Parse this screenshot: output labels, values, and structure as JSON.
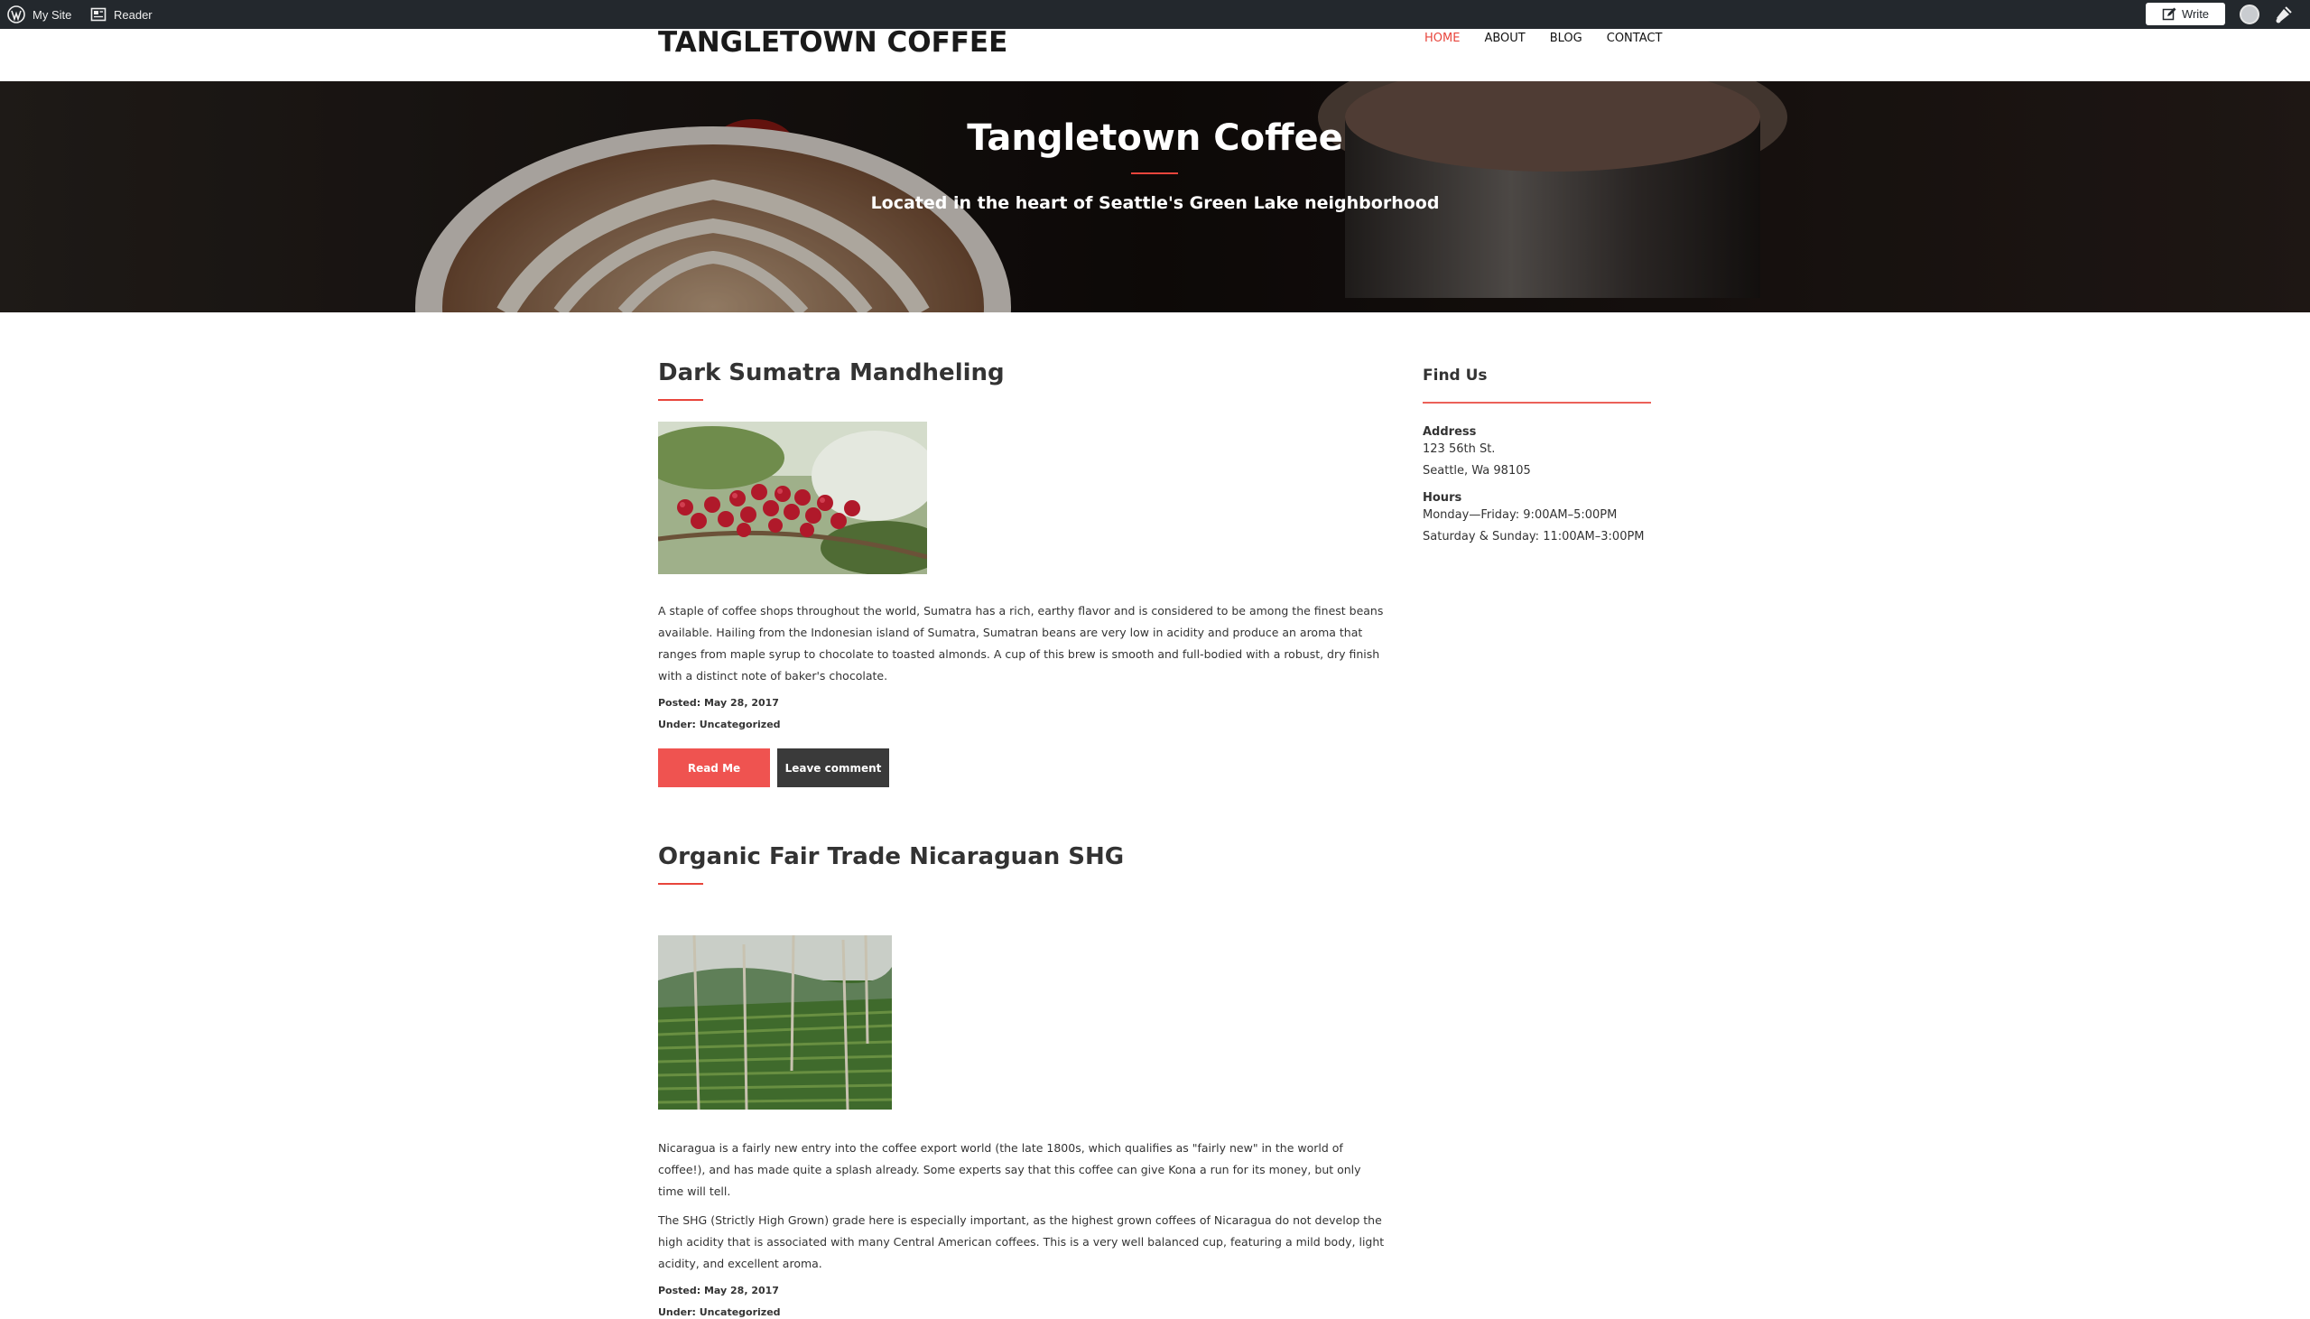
{
  "adminbar": {
    "my_site": "My Site",
    "reader": "Reader",
    "write": "Write"
  },
  "header": {
    "site_title": "TANGLETOWN COFFEE",
    "nav": [
      {
        "label": "HOME",
        "active": true
      },
      {
        "label": "ABOUT",
        "active": false
      },
      {
        "label": "BLOG",
        "active": false
      },
      {
        "label": "CONTACT",
        "active": false
      }
    ]
  },
  "hero": {
    "title": "Tangletown Coffee",
    "subtitle": "Located in the heart of Seattle's Green Lake neighborhood"
  },
  "posts": [
    {
      "title": "Dark Sumatra Mandheling",
      "paragraphs": [
        "A staple of coffee shops throughout the world, Sumatra has a rich, earthy flavor and is considered to be among the finest beans available. Hailing from the Indonesian island of Sumatra, Sumatran beans are very low in acidity and produce an aroma that ranges from maple syrup to chocolate to toasted almonds. A cup of this brew is smooth and full-bodied with a robust, dry finish with a distinct note of baker's chocolate."
      ],
      "posted": "Posted: May 28, 2017",
      "under": "Under: Uncategorized",
      "read_label": "Read Me",
      "comment_label": "Leave comment"
    },
    {
      "title": "Organic Fair Trade Nicaraguan SHG",
      "paragraphs": [
        "Nicaragua is a fairly new entry into the coffee export world (the late 1800s, which qualifies as \"fairly new\" in the world of coffee!), and has made quite a splash already. Some experts say that this coffee can give Kona a run for its money, but only time will tell.",
        "The SHG (Strictly High Grown) grade here is especially important, as the highest grown coffees of Nicaragua do not develop the high acidity that is associated with many Central American coffees. This is a very well balanced cup, featuring a mild body, light acidity, and excellent aroma."
      ],
      "posted": "Posted: May 28, 2017",
      "under": "Under: Uncategorized"
    }
  ],
  "sidebar": {
    "widget_title": "Find Us",
    "address_label": "Address",
    "address_line1": "123 56th St.",
    "address_line2": "Seattle, Wa 98105",
    "hours_label": "Hours",
    "hours_line1": "Monday—Friday: 9:00AM–5:00PM",
    "hours_line2": "Saturday & Sunday: 11:00AM–3:00PM"
  },
  "colors": {
    "accent": "#e8453c",
    "adminbar": "#23282d",
    "button_dark": "#3a3a3a"
  }
}
